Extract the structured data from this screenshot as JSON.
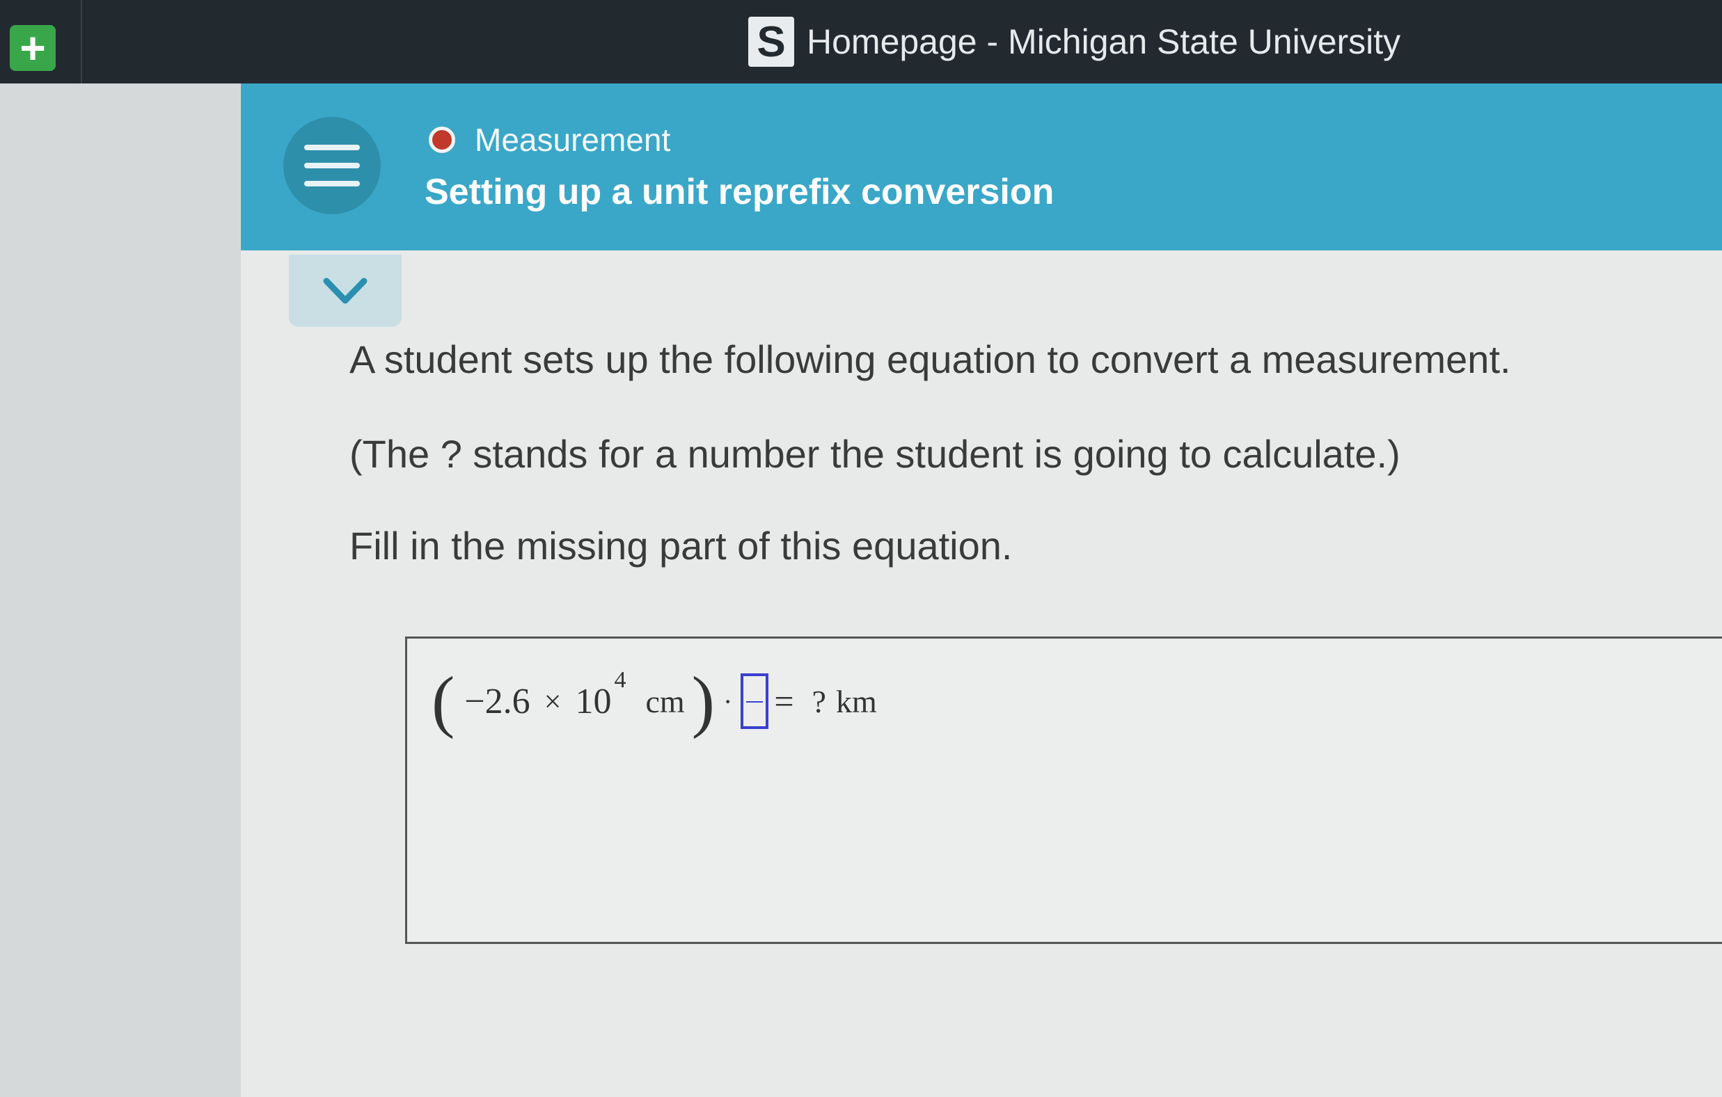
{
  "browser": {
    "title": "Homepage - Michigan State University",
    "logo_letter": "S",
    "new_tab_symbol": "+"
  },
  "header": {
    "topic": "Measurement",
    "topic_status_color": "#c0392b",
    "lesson_title": "Setting up a unit reprefix conversion",
    "accent_color": "#3aa7c8"
  },
  "question": {
    "line1": "A student sets up the following equation to convert a measurement.",
    "line2": "(The ? stands for a number the student is going to calculate.)",
    "line3": "Fill in the missing part of this equation."
  },
  "equation": {
    "open_paren": "(",
    "number": "−2.6",
    "times": "×",
    "base": "10",
    "exponent": "4",
    "unit": "cm",
    "close_paren": ")",
    "dot": "·",
    "equals": "=",
    "unknown": "?",
    "result_unit": "km"
  }
}
